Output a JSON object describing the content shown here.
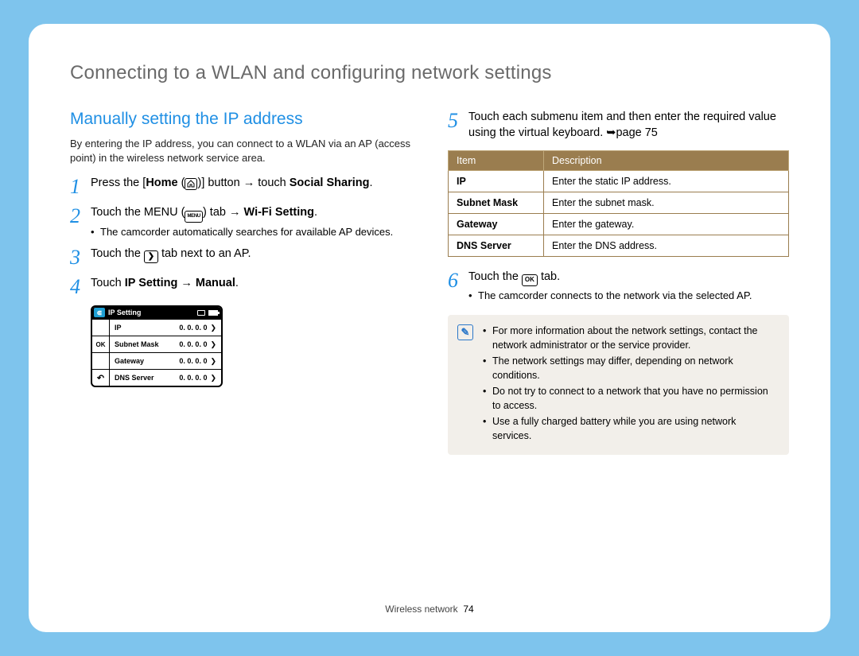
{
  "page_title": "Connecting to a WLAN and configuring network settings",
  "section_title": "Manually setting the IP address",
  "intro_text": "By entering the IP address, you can connect to a WLAN via an AP (access point) in the wireless network service area.",
  "steps_left": {
    "s1": {
      "num": "1",
      "prefix": "Press the [",
      "home_word": "Home",
      "home_icon": "home-icon",
      "mid": "] button ",
      "arrow": "→",
      "after": " touch ",
      "bold_end": "Social Sharing",
      "period": "."
    },
    "s2": {
      "num": "2",
      "prefix": "Touch the MENU (",
      "menu_icon": "MENU",
      "mid": ") tab ",
      "arrow": "→",
      "after": " ",
      "bold_end": "Wi-Fi Setting",
      "period": ".",
      "sub": "The camcorder automatically searches for available AP devices."
    },
    "s3": {
      "num": "3",
      "prefix": "Touch the ",
      "chev_icon": "chevron-right-icon",
      "suffix": " tab next to an AP."
    },
    "s4": {
      "num": "4",
      "prefix": "Touch ",
      "bold1": "IP Setting",
      "arrow": " → ",
      "bold2": "Manual",
      "period": "."
    }
  },
  "mini_panel": {
    "title": "IP Setting",
    "ok_label": "OK",
    "rows": [
      {
        "label": "IP",
        "value": "0. 0. 0. 0"
      },
      {
        "label": "Subnet Mask",
        "value": "0. 0. 0. 0"
      },
      {
        "label": "Gateway",
        "value": "0. 0. 0. 0"
      },
      {
        "label": "DNS Server",
        "value": "0. 0. 0. 0"
      }
    ]
  },
  "steps_right": {
    "s5": {
      "num": "5",
      "text_a": "Touch each submenu item and then enter the required value using the virtual keyboard. ",
      "page_ref_icon": "➥",
      "page_ref": "page 75"
    },
    "s6": {
      "num": "6",
      "prefix": "Touch the ",
      "ok_icon": "OK",
      "suffix": " tab.",
      "sub": "The camcorder connects to the network via the selected AP."
    }
  },
  "table": {
    "h1": "Item",
    "h2": "Description",
    "rows": [
      {
        "item": "IP",
        "desc": "Enter the static IP address."
      },
      {
        "item": "Subnet Mask",
        "desc": "Enter the subnet mask."
      },
      {
        "item": "Gateway",
        "desc": "Enter the gateway."
      },
      {
        "item": "DNS Server",
        "desc": "Enter the DNS address."
      }
    ]
  },
  "notes": [
    "For more information about the network settings, contact the network administrator or the service provider.",
    "The network settings may differ, depending on network conditions.",
    "Do not try to connect to a network that you have no permission to access.",
    "Use a fully charged battery while you are using network services."
  ],
  "footer_section": "Wireless network",
  "footer_page": "74"
}
